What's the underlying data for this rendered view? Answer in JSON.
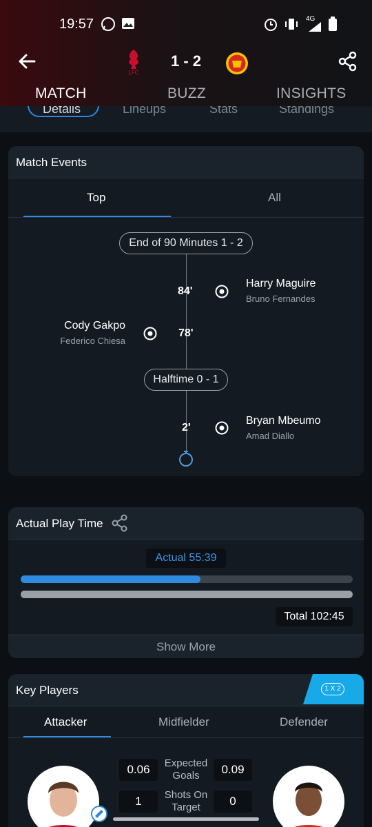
{
  "status_bar": {
    "time": "19:57",
    "network": "4G"
  },
  "header": {
    "score": "1 - 2",
    "home_crest_text": "LFC"
  },
  "main_tabs": [
    {
      "label": "MATCH",
      "active": true
    },
    {
      "label": "BUZZ",
      "active": false
    },
    {
      "label": "INSIGHTS",
      "active": false
    }
  ],
  "sub_tabs": [
    "Details",
    "Lineups",
    "Stats",
    "Standings"
  ],
  "match_events": {
    "title": "Match Events",
    "tabs": [
      "Top",
      "All"
    ],
    "markers": [
      "End of 90 Minutes 1 - 2",
      "Halftime 0 - 1"
    ],
    "events": [
      {
        "minute": "84'",
        "player": "Harry Maguire",
        "assist": "Bruno Fernandes",
        "side": "away"
      },
      {
        "minute": "78'",
        "player": "Cody Gakpo",
        "assist": "Federico Chiesa",
        "side": "home"
      },
      {
        "minute": "2'",
        "player": "Bryan Mbeumo",
        "assist": "Amad Diallo",
        "side": "away"
      }
    ]
  },
  "actual_play_time": {
    "title": "Actual Play Time",
    "actual_label": "Actual 55:39",
    "total_label": "Total 102:45",
    "actual_fraction": 0.5415,
    "show_more": "Show More"
  },
  "key_players": {
    "title": "Key Players",
    "odds_badge": "1 X 2",
    "tabs": [
      "Attacker",
      "Midfielder",
      "Defender"
    ],
    "stats": [
      {
        "label": "Expected Goals",
        "home": "0.06",
        "away": "0.09"
      },
      {
        "label": "Shots On Target",
        "home": "1",
        "away": "0"
      }
    ]
  },
  "colors": {
    "accent": "#2f8ae0",
    "card": "#1a232c",
    "odds": "#17a9e8"
  }
}
